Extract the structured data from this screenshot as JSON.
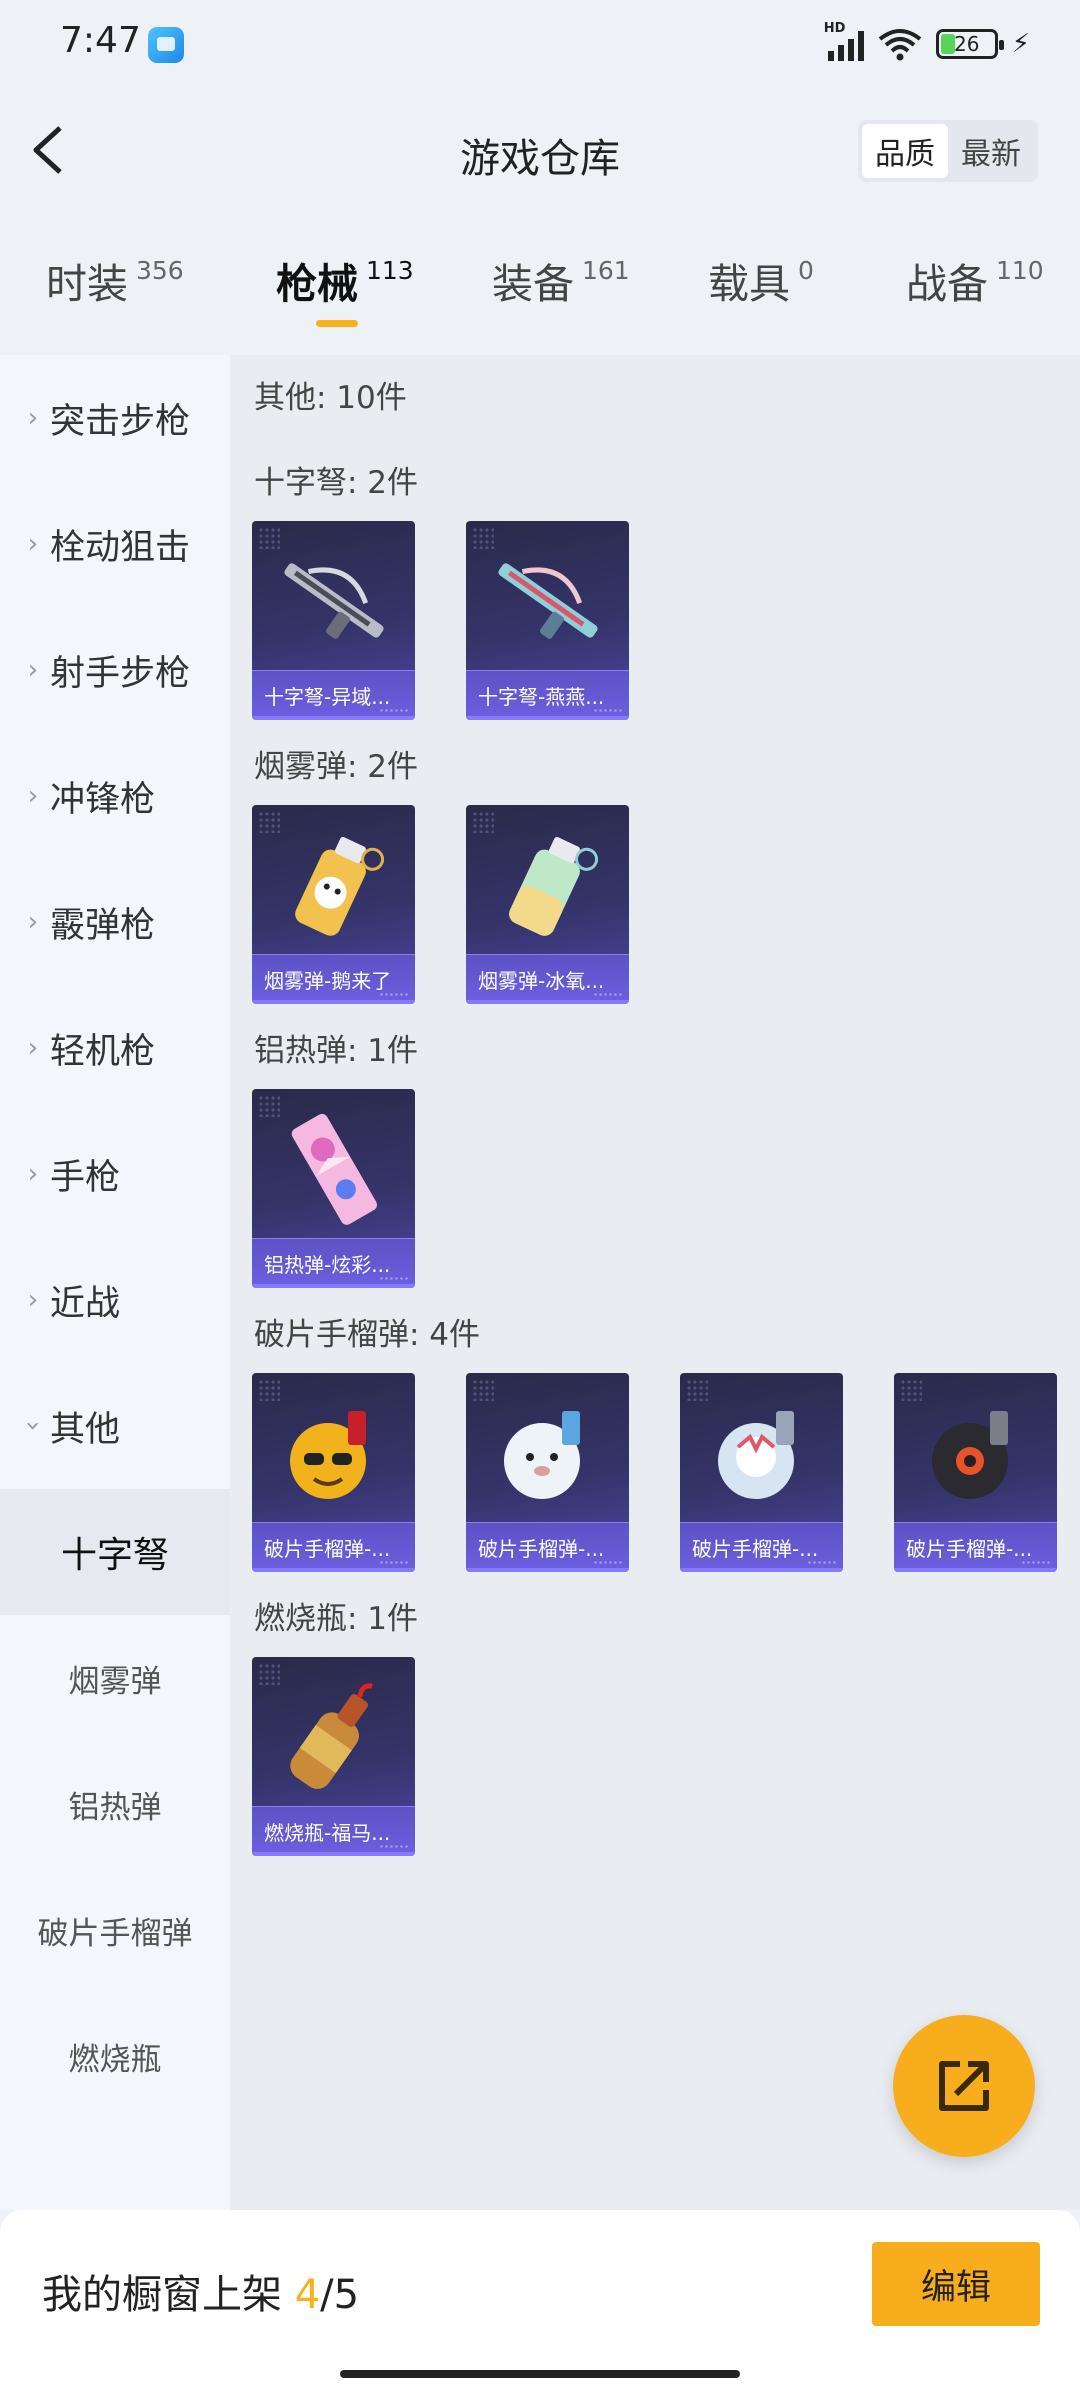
{
  "status_bar": {
    "time": "7:47",
    "battery": "26",
    "network": "HD"
  },
  "header": {
    "title": "游戏仓库",
    "sort_options": [
      "品质",
      "最新"
    ],
    "sort_active": "品质"
  },
  "tabs": [
    {
      "label": "时装",
      "count": "356"
    },
    {
      "label": "枪械",
      "count": "113"
    },
    {
      "label": "装备",
      "count": "161"
    },
    {
      "label": "载具",
      "count": "0"
    },
    {
      "label": "战备",
      "count": "110"
    }
  ],
  "active_tab": "枪械",
  "sidebar": {
    "categories": [
      "突击步枪",
      "栓动狙击",
      "射手步枪",
      "冲锋枪",
      "霰弹枪",
      "轻机枪",
      "手枪",
      "近战",
      "其他"
    ],
    "subcategories": [
      "十字弩",
      "烟雾弹",
      "铝热弹",
      "破片手榴弹",
      "燃烧瓶"
    ],
    "active_sub": "十字弩"
  },
  "content": {
    "summary": "其他: 10件",
    "sections": [
      {
        "title": "十字弩: 2件",
        "items": [
          "十字弩-异域...",
          "十字弩-燕燕..."
        ]
      },
      {
        "title": "烟雾弹: 2件",
        "items": [
          "烟雾弹-鹅来了",
          "烟雾弹-冰氧..."
        ]
      },
      {
        "title": "铝热弹: 1件",
        "items": [
          "铝热弹-炫彩..."
        ]
      },
      {
        "title": "破片手榴弹: 4件",
        "items": [
          "破片手榴弹-...",
          "破片手榴弹-...",
          "破片手榴弹-...",
          "破片手榴弹-..."
        ]
      },
      {
        "title": "燃烧瓶: 1件",
        "items": [
          "燃烧瓶-福马..."
        ]
      }
    ]
  },
  "bottom": {
    "showcase_label": "我的橱窗上架",
    "showcase_count": "4",
    "showcase_total": "/5",
    "edit_label": "编辑"
  },
  "icons": [
    "back-arrow-icon",
    "share-external-icon",
    "signal-icon",
    "wifi-icon",
    "battery-icon",
    "charging-icon"
  ],
  "colors": {
    "accent": "#f8ae1c",
    "card_caption": "#6d5fe0",
    "page_bg": "#eef2f7"
  }
}
